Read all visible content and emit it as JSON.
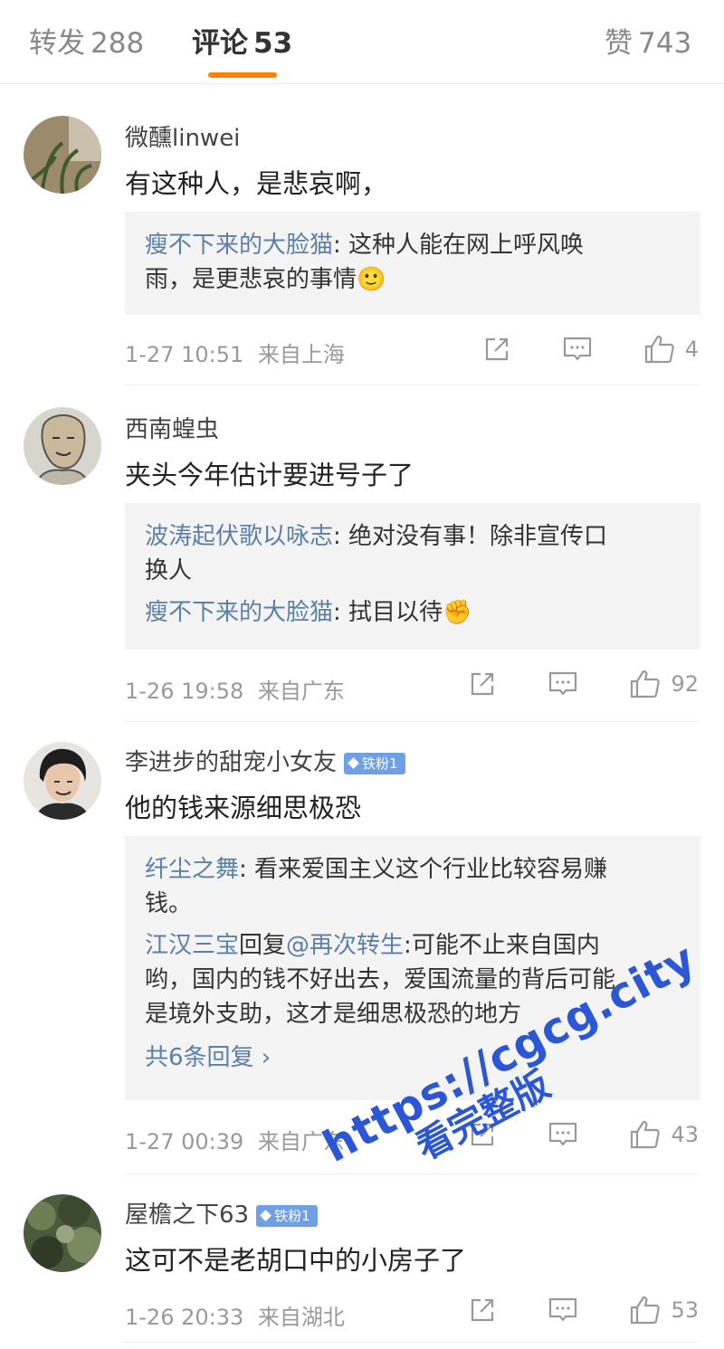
{
  "tabs": [
    {
      "label": "转发",
      "count": "288"
    },
    {
      "label": "评论",
      "count": "53"
    },
    {
      "label": "赞",
      "count": "743"
    }
  ],
  "comments": [
    {
      "user": "微醺linwei",
      "text": "有这种人，是悲哀啊，",
      "replies": [
        {
          "name": "瘦不下来的大脸猫",
          "sep": ": ",
          "text": "这种人能在网上呼风唤",
          "text2": "雨，是更悲哀的事情🙂"
        }
      ],
      "time": "1-27 10:51",
      "source": "来自上海",
      "likes": "4"
    },
    {
      "user": "西南蝗虫",
      "text": "夹头今年估计要进号子了",
      "replies": [
        {
          "name": "波涛起伏歌以咏志",
          "sep": ": ",
          "text": "绝对没有事！除非宣传口",
          "text2": "换人"
        },
        {
          "name": "瘦不下来的大脸猫",
          "sep": ": ",
          "text": "拭目以待✊"
        }
      ],
      "time": "1-26 19:58",
      "source": "来自广东",
      "likes": "92"
    },
    {
      "user": "李进步的甜宠小女友",
      "badge": "铁粉1",
      "text": "他的钱来源细思极恐",
      "replies": [
        {
          "name": "纤尘之舞",
          "sep": ": ",
          "text": "看来爱国主义这个行业比较容易赚",
          "text2": "钱。"
        },
        {
          "name": "江汉三宝",
          "mid": "回复",
          "at": "@再次转生",
          "sep": ":",
          "text": "可能不止来自国内",
          "text2": "哟，国内的钱不好出去，爱国流量的背后可能",
          "text3": "是境外支助，这才是细思极恐的地方"
        }
      ],
      "more": "共6条回复 ›",
      "time": "1-27 00:39",
      "source": "来自广东",
      "likes": "43"
    },
    {
      "user": "屋檐之下63",
      "badge": "铁粉1",
      "text": "这可不是老胡口中的小房子了",
      "time": "1-26 20:33",
      "source": "来自湖北",
      "likes": "53"
    }
  ],
  "watermark": {
    "line1": "https://cgcg.city",
    "line2": "看完整版"
  },
  "colors": {
    "accent": "#ff8200",
    "link": "#5a7fa8",
    "badge": "#6fa0e6",
    "watermark": "#2b57d6"
  }
}
